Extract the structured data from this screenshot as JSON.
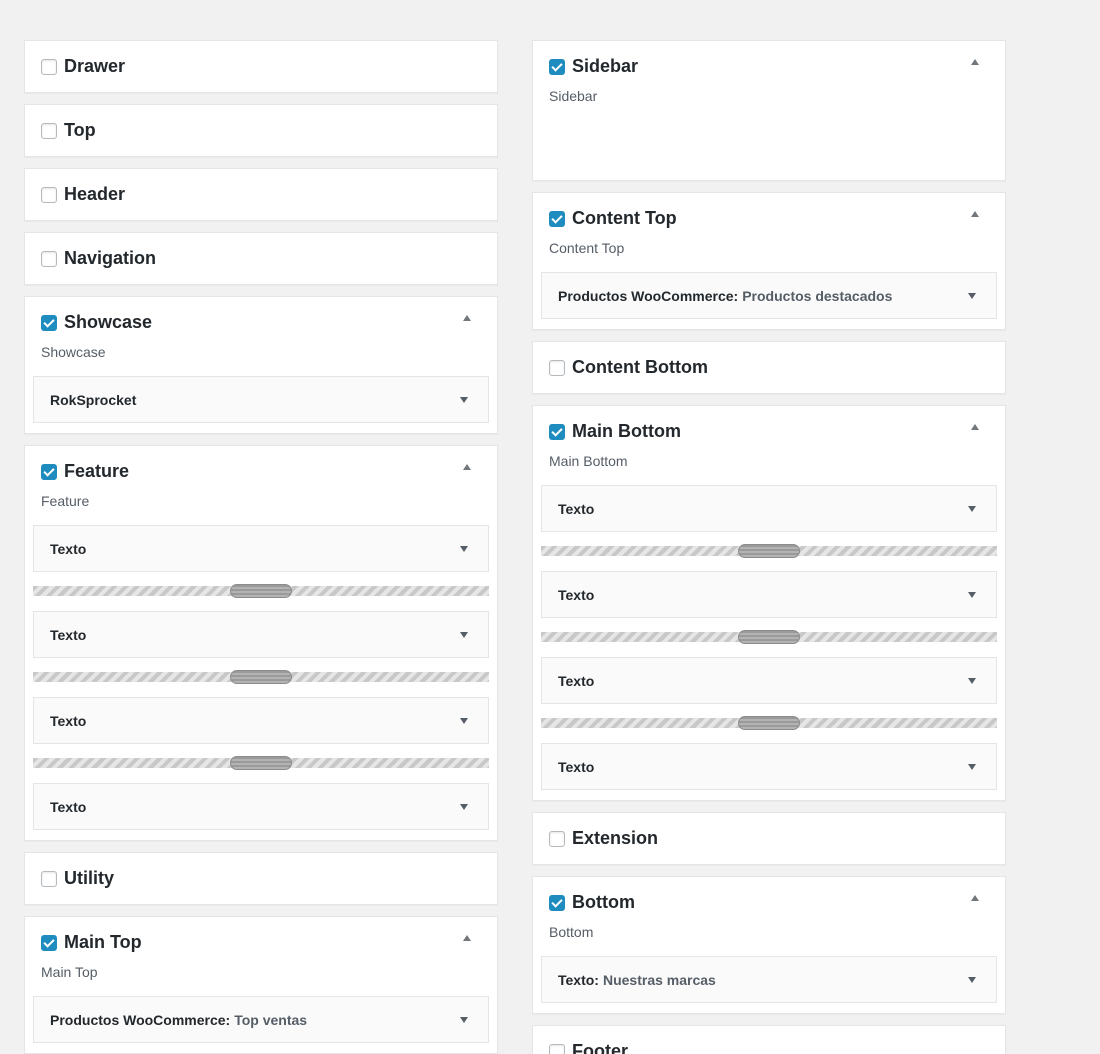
{
  "left": {
    "drawer": {
      "title": "Drawer",
      "checked": false
    },
    "top": {
      "title": "Top",
      "checked": false
    },
    "header": {
      "title": "Header",
      "checked": false
    },
    "navigation": {
      "title": "Navigation",
      "checked": false
    },
    "showcase": {
      "title": "Showcase",
      "checked": true,
      "description": "Showcase",
      "widgets": [
        {
          "title": "RokSprocket",
          "subtitle": ""
        }
      ]
    },
    "feature": {
      "title": "Feature",
      "checked": true,
      "description": "Feature",
      "widgets": [
        {
          "title": "Texto"
        },
        {
          "title": "Texto"
        },
        {
          "title": "Texto"
        },
        {
          "title": "Texto"
        }
      ]
    },
    "utility": {
      "title": "Utility",
      "checked": false
    },
    "main_top": {
      "title": "Main Top",
      "checked": true,
      "description": "Main Top",
      "widgets": [
        {
          "title": "Productos WooCommerce:",
          "subtitle": "Top ventas"
        }
      ]
    }
  },
  "right": {
    "sidebar": {
      "title": "Sidebar",
      "checked": true,
      "description": "Sidebar"
    },
    "content_top": {
      "title": "Content Top",
      "checked": true,
      "description": "Content Top",
      "widgets": [
        {
          "title": "Productos WooCommerce:",
          "subtitle": "Productos destacados"
        }
      ]
    },
    "content_bottom": {
      "title": "Content Bottom",
      "checked": false
    },
    "main_bottom": {
      "title": "Main Bottom",
      "checked": true,
      "description": "Main Bottom",
      "widgets": [
        {
          "title": "Texto"
        },
        {
          "title": "Texto"
        },
        {
          "title": "Texto"
        },
        {
          "title": "Texto"
        }
      ]
    },
    "extension": {
      "title": "Extension",
      "checked": false
    },
    "bottom": {
      "title": "Bottom",
      "checked": true,
      "description": "Bottom",
      "widgets": [
        {
          "title": "Texto:",
          "subtitle": "Nuestras marcas"
        }
      ]
    },
    "footer": {
      "title": "Footer",
      "checked": false
    }
  },
  "colors": {
    "checkbox_on": "#1e8cbe",
    "background": "#f1f1f1",
    "panel": "#ffffff"
  },
  "icons": {
    "collapse": "triangle-up-icon",
    "expand": "triangle-down-icon",
    "splitter": "splitter-handle-icon"
  }
}
